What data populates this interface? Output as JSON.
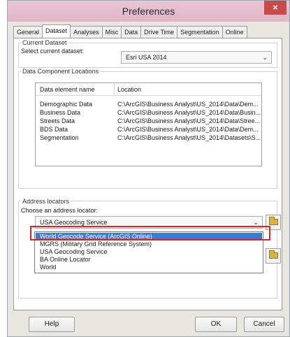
{
  "window": {
    "title": "Preferences",
    "close_glyph": "×"
  },
  "tabs": [
    "General",
    "Dataset",
    "Analyses",
    "Misc",
    "Data",
    "Drive Time",
    "Segmentation",
    "Online"
  ],
  "active_tab": "Dataset",
  "current_dataset": {
    "group_label": "Current Dataset",
    "select_label": "Select current dataset:",
    "value": "Esri USA 2014"
  },
  "data_components": {
    "group_label": "Data Component Locations",
    "columns": [
      "Data element name",
      "Location"
    ],
    "rows": [
      [
        "Demographic Data",
        "C:\\ArcGIS\\Business Analyst\\US_2014\\Data\\Dem..."
      ],
      [
        "Business Data",
        "C:\\ArcGIS\\Business Analyst\\US_2014\\Data\\Busin..."
      ],
      [
        "Streets Data",
        "C:\\ArcGIS\\Business Analyst\\US_2014\\Data\\Stree..."
      ],
      [
        "BDS Data",
        "C:\\ArcGIS\\Business Analyst\\US_2014\\Data\\Dem..."
      ],
      [
        "Segmentation",
        "C:\\ArcGIS\\Business Analyst\\US_2014\\Datasets\\S..."
      ]
    ]
  },
  "address_locators": {
    "group_label": "Address locators",
    "choose_label": "Choose an address locator:",
    "value": "USA Geocoding Service",
    "options": [
      "World Geocode Service (ArcGIS Online)",
      "MGRS (Military Grid Reference System)",
      "USA Geocoding Service",
      "BA Online Locator",
      "World"
    ],
    "highlighted_index": 0
  },
  "buttons": {
    "help": "Help",
    "ok": "OK",
    "cancel": "Cancel"
  },
  "colors": {
    "highlight": "#3a7bd5",
    "callout_border": "#d4262b",
    "close_button": "#c94a4a"
  }
}
